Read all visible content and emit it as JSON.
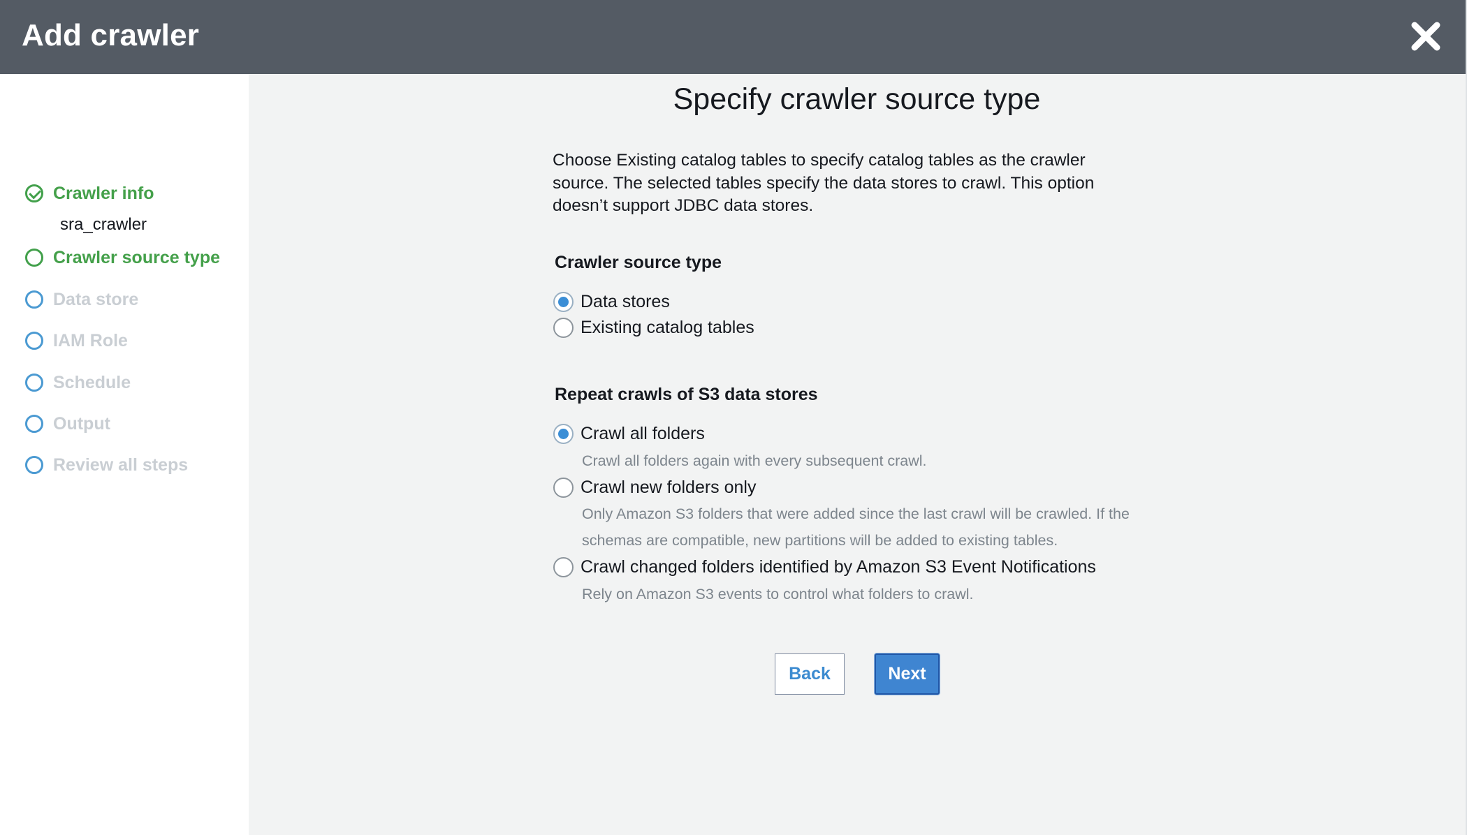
{
  "header": {
    "title": "Add crawler",
    "close_icon": "close-icon"
  },
  "sidebar": {
    "steps": [
      {
        "label": "Crawler info",
        "state": "done",
        "sub": "sra_crawler"
      },
      {
        "label": "Crawler source type",
        "state": "current"
      },
      {
        "label": "Data store",
        "state": "pending"
      },
      {
        "label": "IAM Role",
        "state": "pending"
      },
      {
        "label": "Schedule",
        "state": "pending"
      },
      {
        "label": "Output",
        "state": "pending"
      },
      {
        "label": "Review all steps",
        "state": "pending"
      }
    ]
  },
  "main": {
    "title": "Specify crawler source type",
    "description_lines": [
      "Choose Existing catalog tables to specify catalog tables as the crawler",
      "source. The selected tables specify the data stores to crawl. This option",
      "doesn’t support JDBC data stores."
    ],
    "source_type": {
      "heading": "Crawler source type",
      "options": [
        {
          "label": "Data stores",
          "selected": true
        },
        {
          "label": "Existing catalog tables",
          "selected": false
        }
      ]
    },
    "repeat_crawls": {
      "heading": "Repeat crawls of S3 data stores",
      "options": [
        {
          "label": "Crawl all folders",
          "selected": true,
          "help": [
            "Crawl all folders again with every subsequent crawl."
          ]
        },
        {
          "label": "Crawl new folders only",
          "selected": false,
          "help": [
            "Only Amazon S3 folders that were added since the last crawl will be crawled. If the",
            "schemas are compatible, new partitions will be added to existing tables."
          ]
        },
        {
          "label": "Crawl changed folders identified by Amazon S3 Event Notifications",
          "selected": false,
          "help": [
            "Rely on Amazon S3 events to control what folders to crawl."
          ]
        }
      ]
    },
    "buttons": {
      "back": "Back",
      "next": "Next"
    }
  },
  "colors": {
    "header_bg": "#545b64",
    "step_done": "#44a04a",
    "step_pending_ring": "#4b9ad2",
    "accent": "#3f85d1"
  }
}
